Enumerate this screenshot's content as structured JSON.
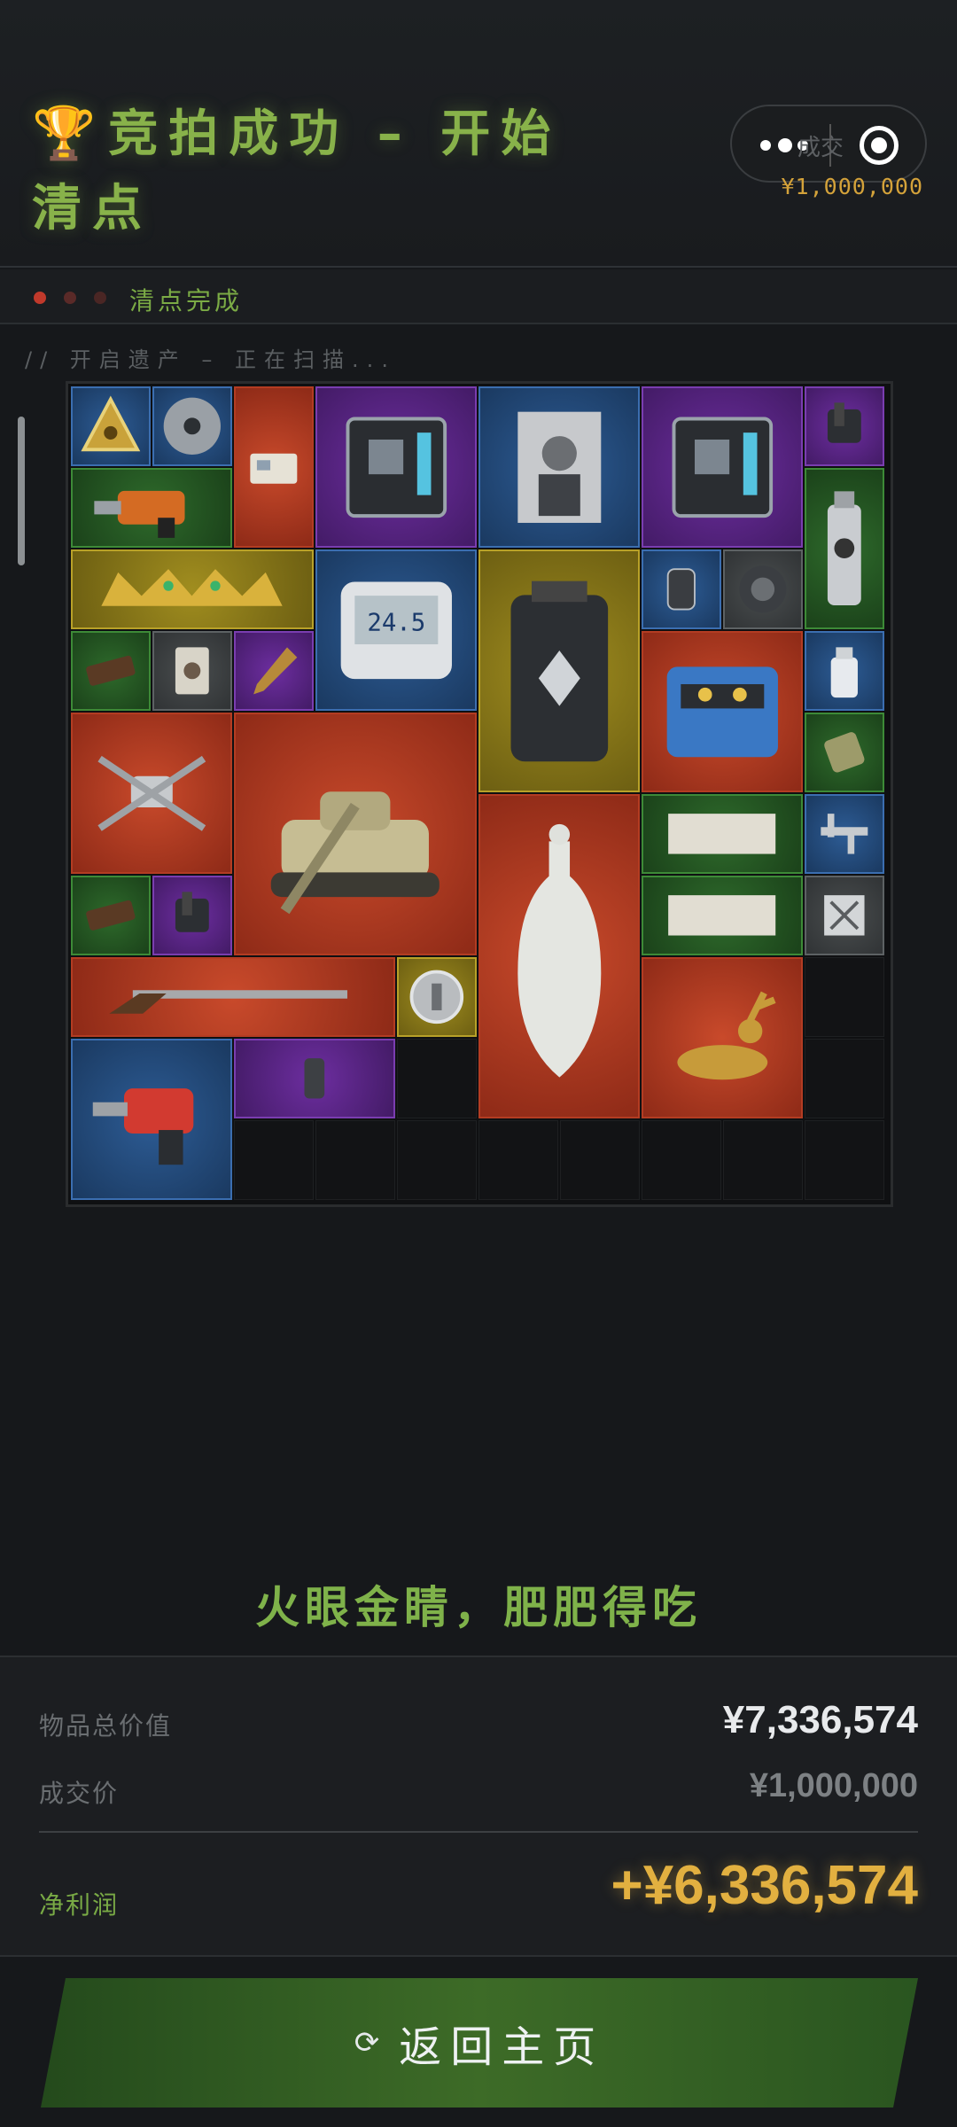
{
  "header": {
    "trophy_icon": "🏆",
    "title": "竞拍成功 – 开始清点",
    "price_label": "成交",
    "price_value": "¥1,000,000"
  },
  "status": {
    "text": "清点完成",
    "led_colors": [
      "#c0392b",
      "#5a2a28",
      "#4a2624"
    ]
  },
  "scan_text": "// 开启遗产 – 正在扫描...",
  "grid": {
    "items": [
      {
        "name": "triangle-badge",
        "rarity": "blue"
      },
      {
        "name": "cd-disc",
        "rarity": "blue"
      },
      {
        "name": "keycard",
        "rarity": "red"
      },
      {
        "name": "motherboard",
        "rarity": "purple"
      },
      {
        "name": "magazine-urban-chic",
        "rarity": "blue"
      },
      {
        "name": "motherboard",
        "rarity": "purple"
      },
      {
        "name": "tool-clamp",
        "rarity": "purple"
      },
      {
        "name": "power-drill",
        "rarity": "green"
      },
      {
        "name": "spray-can",
        "rarity": "green"
      },
      {
        "name": "jeweled-crown",
        "rarity": "gold"
      },
      {
        "name": "digital-thermometer",
        "rarity": "blue"
      },
      {
        "name": "battery-case",
        "rarity": "gold"
      },
      {
        "name": "smart-watch",
        "rarity": "blue"
      },
      {
        "name": "duct-tape",
        "rarity": "gray"
      },
      {
        "name": "energy-bar",
        "rarity": "green"
      },
      {
        "name": "playing-card",
        "rarity": "gray"
      },
      {
        "name": "arrowhead",
        "rarity": "purple"
      },
      {
        "name": "engine-module",
        "rarity": "red"
      },
      {
        "name": "medicine-bottle",
        "rarity": "blue"
      },
      {
        "name": "drone",
        "rarity": "red"
      },
      {
        "name": "tank-model",
        "rarity": "red"
      },
      {
        "name": "bandage-pack",
        "rarity": "green"
      },
      {
        "name": "ancient-scroll",
        "rarity": "green"
      },
      {
        "name": "vernier-caliper",
        "rarity": "blue"
      },
      {
        "name": "porcelain-vase",
        "rarity": "red"
      },
      {
        "name": "energy-bar",
        "rarity": "green"
      },
      {
        "name": "tool-clamp",
        "rarity": "purple"
      },
      {
        "name": "ancient-scroll",
        "rarity": "green"
      },
      {
        "name": "sealed-document",
        "rarity": "gray"
      },
      {
        "name": "flintlock-rifle",
        "rarity": "red"
      },
      {
        "name": "coin-token",
        "rarity": "gold"
      },
      {
        "name": "golden-deer",
        "rarity": "red"
      },
      {
        "name": "rotary-hammer",
        "rarity": "blue"
      },
      {
        "name": "armor-plate",
        "rarity": "purple"
      }
    ]
  },
  "slogan": "火眼金睛，肥肥得吃",
  "summary": {
    "total_label": "物品总价值",
    "total_value": "¥7,336,574",
    "deal_label": "成交价",
    "deal_value": "¥1,000,000",
    "profit_label": "净利润",
    "profit_value": "+¥6,336,574"
  },
  "home_button": {
    "icon": "refresh-icon",
    "label": "返回主页"
  }
}
